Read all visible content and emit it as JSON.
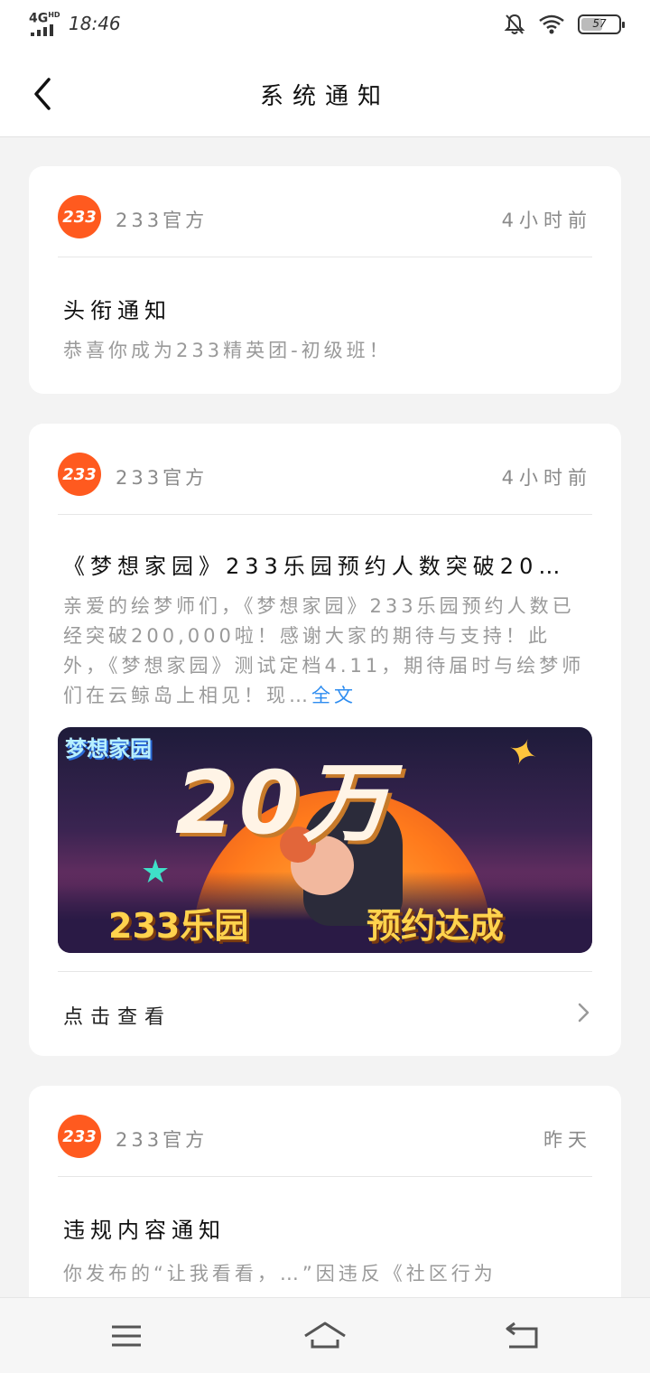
{
  "status_bar": {
    "network": "4G",
    "network_sup": "HD",
    "time": "18:46",
    "battery": "57",
    "battery_level": 0.57
  },
  "header": {
    "title": "系统通知"
  },
  "notifications": [
    {
      "avatar_text": "233",
      "sender": "233官方",
      "time_ago": "4小时前",
      "title": "头衔通知",
      "body": "恭喜你成为233精英团-初级班！"
    },
    {
      "avatar_text": "233",
      "sender": "233官方",
      "time_ago": "4小时前",
      "title": "《梦想家园》233乐园预约人数突破20…",
      "body": "亲爱的绘梦师们，《梦想家园》233乐园预约人数已经突破200,000啦！感谢大家的期待与支持！此外，《梦想家园》测试定档4.11，期待届时与绘梦师们在云鲸岛上相见！现…",
      "full_text_link": "全文",
      "banner": {
        "logo": "梦想家园",
        "headline": "20万",
        "tag_left": "233乐园",
        "tag_right": "预约达成"
      },
      "view_label": "点击查看"
    },
    {
      "avatar_text": "233",
      "sender": "233官方",
      "time_ago": "昨天",
      "title": "违规内容通知",
      "body": "你发布的“让我看看，…”因违反《社区行为"
    }
  ],
  "nav": {
    "menu": "menu-icon",
    "home": "home-icon",
    "back": "back-icon"
  }
}
